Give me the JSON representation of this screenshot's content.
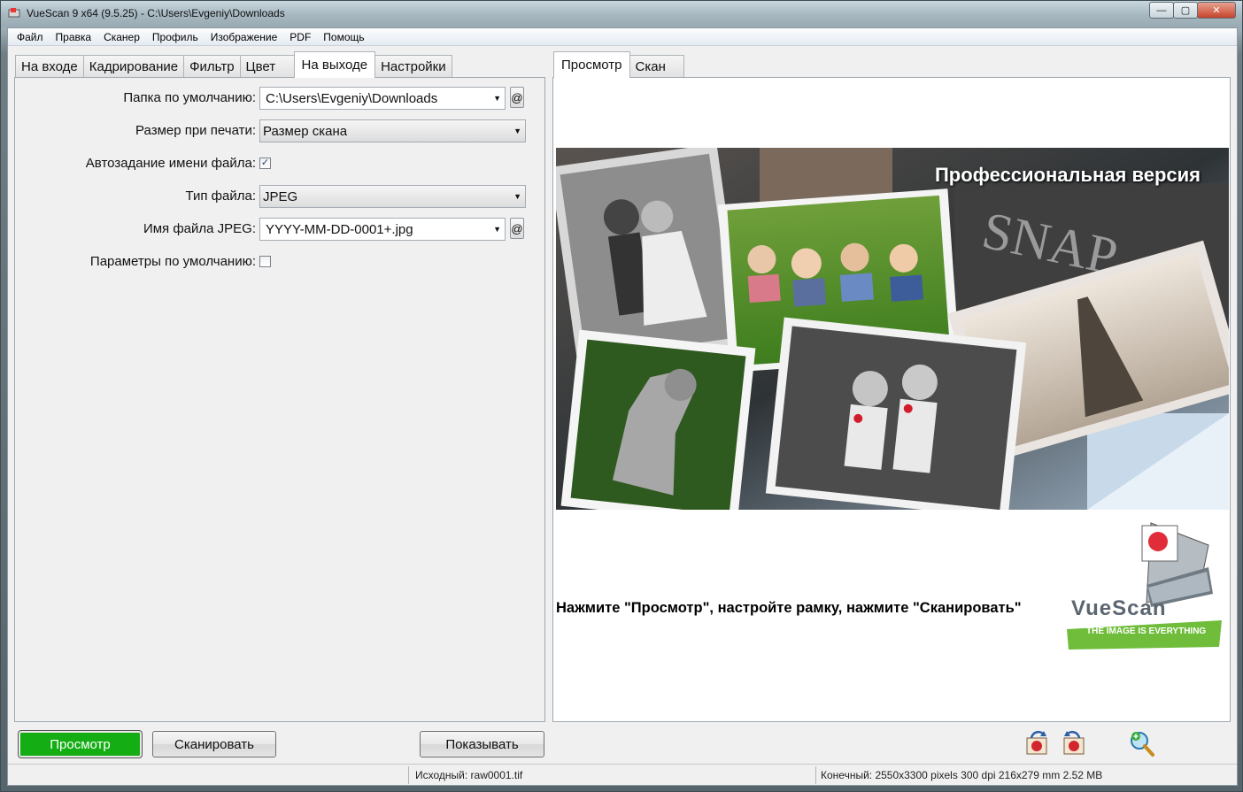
{
  "window": {
    "title": "VueScan 9 x64 (9.5.25) - C:\\Users\\Evgeniy\\Downloads",
    "controls": {
      "minimize": "—",
      "maximize": "▢",
      "close": "✕"
    }
  },
  "menu": [
    "Файл",
    "Правка",
    "Сканер",
    "Профиль",
    "Изображение",
    "PDF",
    "Помощь"
  ],
  "left_tabs": [
    "На входе",
    "Кадрирование",
    "Фильтр",
    "Цвет",
    "На выходе",
    "Настройки"
  ],
  "left_active_tab": "На выходе",
  "form": {
    "default_folder_label": "Папка по умолчанию:",
    "default_folder_value": "C:\\Users\\Evgeniy\\Downloads",
    "print_size_label": "Размер при печати:",
    "print_size_value": "Размер скана",
    "auto_filename_label": "Автозадание имени файла:",
    "auto_filename_checked": true,
    "file_type_label": "Тип файла:",
    "file_type_value": "JPEG",
    "jpeg_filename_label": "Имя файла JPEG:",
    "jpeg_filename_value": "YYYY-MM-DD-0001+.jpg",
    "defaults_label": "Параметры по умолчанию:",
    "defaults_checked": false,
    "at_button": "@",
    "checkmark": "✓"
  },
  "right_tabs": [
    "Просмотр",
    "Скан"
  ],
  "right_active_tab": "Просмотр",
  "preview": {
    "banner_text": "Профессиональная версия",
    "hint": "Нажмите \"Просмотр\", настройте рамку, нажмите \"Сканировать\"",
    "logo_name": "VueScan",
    "logo_tagline": "THE IMAGE IS EVERYTHING",
    "banner_word": "SNAP"
  },
  "buttons": {
    "preview": "Просмотр",
    "scan": "Сканировать",
    "show": "Показывать"
  },
  "status": {
    "source": "Исходный: raw0001.tif",
    "output": "Конечный: 2550x3300 pixels 300 dpi 216x279 mm 2.52 MB"
  },
  "colors": {
    "preview_button": "#14ae14",
    "title_bar": "#a8b9c2"
  },
  "icons": [
    "rotate-left-icon",
    "rotate-right-icon",
    "zoom-in-icon"
  ]
}
